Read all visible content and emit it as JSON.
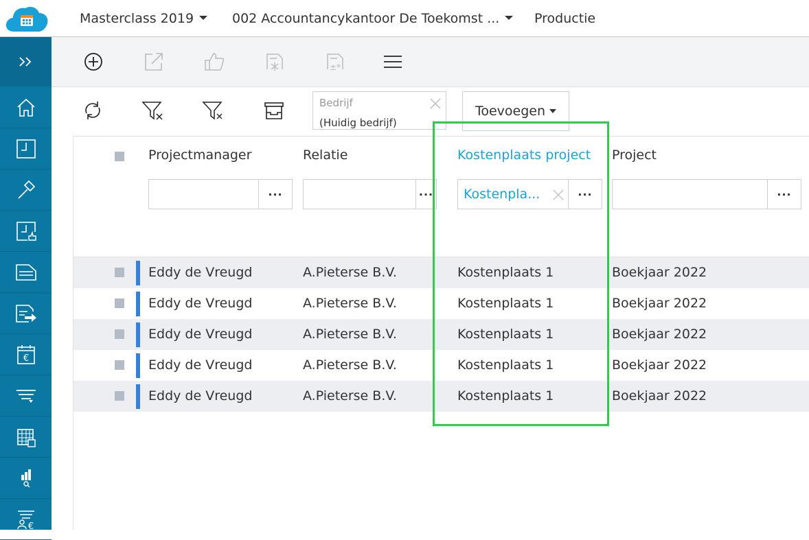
{
  "topbar": {
    "year": "Masterclass 2019",
    "company": "002 Accountancykantoor De Toekomst ...",
    "module": "Productie"
  },
  "sidebar": {
    "items": [
      "expand",
      "home",
      "projects",
      "hammer",
      "approvals",
      "invoices",
      "invoice-send",
      "calendar-euro",
      "filter-list",
      "calendar-grid",
      "report-search",
      "people-euro"
    ]
  },
  "toolbar": {
    "actions": [
      "add",
      "open-external",
      "approve",
      "new-entry",
      "new-entry-plusminus",
      "menu"
    ]
  },
  "filterbar": {
    "company_label": "Bedrijf",
    "company_value": "(Huidig bedrijf)",
    "add_label": "Toevoegen"
  },
  "grid": {
    "columns": [
      {
        "title": "Projectmanager",
        "filter": ""
      },
      {
        "title": "Relatie",
        "filter": ""
      },
      {
        "title": "Kostenplaats project",
        "filter": "Kostenpla..."
      },
      {
        "title": "Project",
        "filter": ""
      }
    ],
    "dots": "···",
    "rows": [
      [
        "Eddy de Vreugd",
        "A.Pieterse B.V.",
        "Kostenplaats 1",
        "Boekjaar 2022"
      ],
      [
        "Eddy de Vreugd",
        "A.Pieterse B.V.",
        "Kostenplaats 1",
        "Boekjaar 2022"
      ],
      [
        "Eddy de Vreugd",
        "A.Pieterse B.V.",
        "Kostenplaats 1",
        "Boekjaar 2022"
      ],
      [
        "Eddy de Vreugd",
        "A.Pieterse B.V.",
        "Kostenplaats 1",
        "Boekjaar 2022"
      ],
      [
        "Eddy de Vreugd",
        "A.Pieterse B.V.",
        "Kostenplaats 1",
        "Boekjaar 2022"
      ]
    ]
  },
  "colors": {
    "sidebar": "#0b78a4",
    "accent": "#1aa3d6",
    "row_marker": "#3a7fd5",
    "highlight": "#2ecc4a"
  }
}
